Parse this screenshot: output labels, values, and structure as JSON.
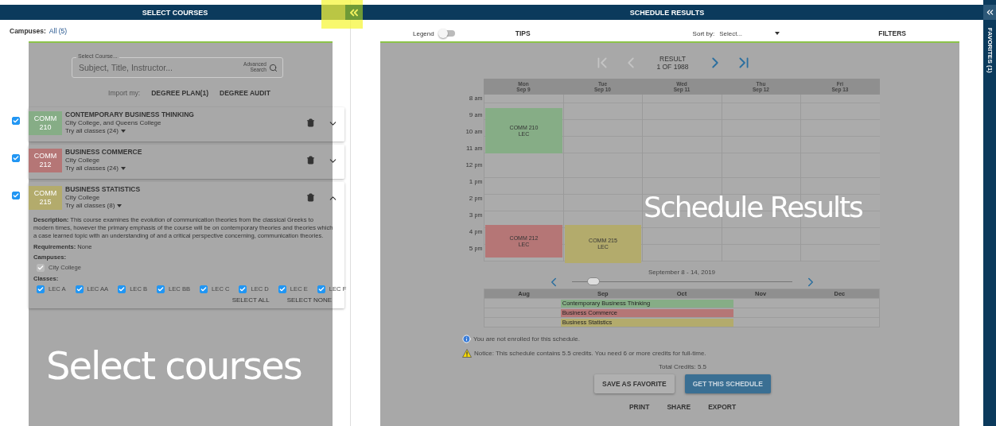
{
  "left_panel": {
    "title": "SELECT COURSES",
    "campuses_label": "Campuses:",
    "campuses_value": "All (5)",
    "search": {
      "label": "Select Course...",
      "placeholder": "Subject, Title, Instructor...",
      "advanced": "Advanced Search"
    },
    "import_label": "Import my:",
    "import_buttons": [
      "DEGREE PLAN(1)",
      "DEGREE AUDIT"
    ],
    "courses": [
      {
        "subject": "COMM",
        "number": "210",
        "title": "CONTEMPORARY BUSINESS THINKING",
        "campus": "City College, and Queens College",
        "classes": "Try all classes (24)",
        "color": "#86ad86",
        "checked": true,
        "expanded": false
      },
      {
        "subject": "COMM",
        "number": "212",
        "title": "BUSINESS COMMERCE",
        "campus": "City College",
        "classes": "Try all classes (24)",
        "color": "#b57676",
        "checked": true,
        "expanded": false
      },
      {
        "subject": "COMM",
        "number": "215",
        "title": "BUSINESS STATISTICS",
        "campus": "City College",
        "classes": "Try all classes (8)",
        "color": "#b3ab6c",
        "checked": true,
        "expanded": true
      }
    ],
    "details": {
      "description_label": "Description:",
      "description": "This course examines the evolution of communication theories from the classical Greeks to modern times, however the primary emphasis of the course will be on contemporary theories and theories which a case learned topic with an understanding of and a critical perspective concerning, communication theories.",
      "requirements_label": "Requirements:",
      "requirements": "None",
      "campuses_label": "Campuses:",
      "campuses": [
        {
          "label": "City College",
          "checked": true,
          "disabled": true
        }
      ],
      "classes_label": "Classes:",
      "classes": [
        {
          "label": "LEC A",
          "checked": true
        },
        {
          "label": "LEC AA",
          "checked": true
        },
        {
          "label": "LEC B",
          "checked": true
        },
        {
          "label": "LEC BB",
          "checked": true
        },
        {
          "label": "LEC C",
          "checked": true
        },
        {
          "label": "LEC D",
          "checked": true
        },
        {
          "label": "LEC E",
          "checked": true
        },
        {
          "label": "LEC F",
          "checked": true
        }
      ],
      "buttons": [
        "SELECT ALL",
        "SELECT NONE"
      ]
    }
  },
  "right_panel": {
    "title": "SCHEDULE RESULTS",
    "legend": {
      "label": "Legend",
      "on": false
    },
    "tips": "TIPS",
    "sort": {
      "label": "Sort by:",
      "value": "Select..."
    },
    "filters": "FILTERS",
    "result": {
      "label": "RESULT",
      "count": "1 OF 1988"
    },
    "nav": [
      {
        "kind": "first",
        "disabled": true
      },
      {
        "kind": "prev",
        "disabled": true
      },
      {
        "kind": "next",
        "disabled": false
      },
      {
        "kind": "last",
        "disabled": false
      }
    ],
    "calendar": {
      "days": [
        {
          "day": "Mon",
          "date": "Sep 9"
        },
        {
          "day": "Tue",
          "date": "Sep 10"
        },
        {
          "day": "Wed",
          "date": "Sep 11"
        },
        {
          "day": "Thu",
          "date": "Sep 12"
        },
        {
          "day": "Fri",
          "date": "Sep 13"
        }
      ],
      "times": [
        {
          "hour": "8",
          "ampm": "am"
        },
        {
          "hour": "9",
          "ampm": "am"
        },
        {
          "hour": "10",
          "ampm": "am"
        },
        {
          "hour": "11",
          "ampm": "am"
        },
        {
          "hour": "12",
          "ampm": "pm"
        },
        {
          "hour": "1",
          "ampm": "pm"
        },
        {
          "hour": "2",
          "ampm": "pm"
        },
        {
          "hour": "3",
          "ampm": "pm"
        },
        {
          "hour": "4",
          "ampm": "pm"
        },
        {
          "hour": "5",
          "ampm": "pm"
        }
      ],
      "events": [
        {
          "code": "COMM 210",
          "type": "LEC",
          "color": "#86ad86"
        },
        {
          "code": "COMM 212",
          "type": "LEC",
          "color": "#b57676"
        },
        {
          "code": "COMM 215",
          "type": "LEC",
          "color": "#b3ab6c"
        }
      ]
    },
    "week": {
      "label": "September 8 - 14, 2019",
      "level": 0.1
    },
    "timeline": {
      "months": [
        "Aug",
        "Sep",
        "Oct",
        "Nov",
        "Dec"
      ],
      "bars": [
        {
          "label": "Contemporary Business Thinking",
          "color": "#86ad86"
        },
        {
          "label": "Business Commerce",
          "color": "#b57676"
        },
        {
          "label": "Business Statistics",
          "color": "#b3ab6c"
        }
      ]
    },
    "notices": [
      {
        "kind": "info",
        "text": "You are not enrolled for this schedule."
      },
      {
        "kind": "warning",
        "text": "Notice: This schedule contains 5.5 credits. You need 6 or more credits for full-time."
      }
    ],
    "total": "Total Credits: 5.5",
    "buttons": [
      {
        "label": "SAVE AS FAVORITE",
        "kind": "secondary"
      },
      {
        "label": "GET THIS SCHEDULE",
        "kind": "primary"
      }
    ],
    "links": [
      "PRINT",
      "SHARE",
      "EXPORT"
    ]
  },
  "favorites": {
    "label": "FAVORITES (1)"
  },
  "annotations": [
    "Select courses",
    "Schedule Results"
  ]
}
